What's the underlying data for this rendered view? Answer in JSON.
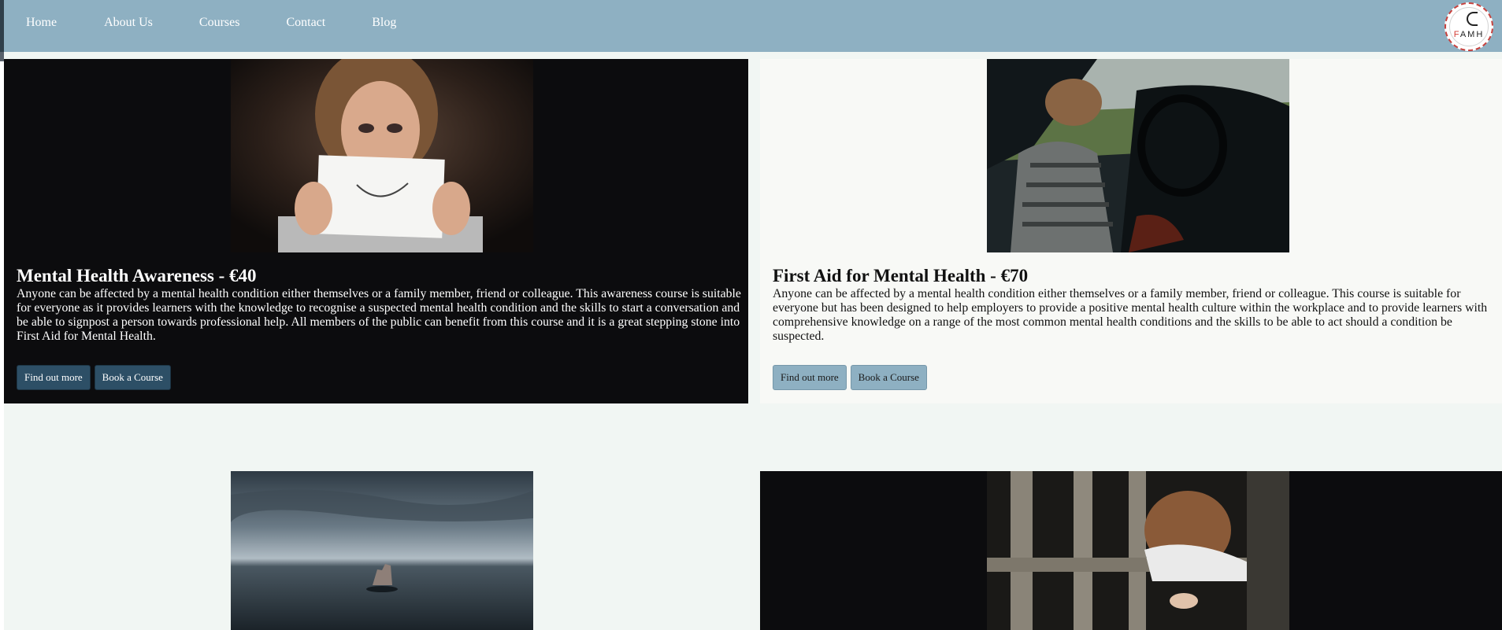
{
  "nav": {
    "items": [
      {
        "label": "Home"
      },
      {
        "label": "About Us"
      },
      {
        "label": "Courses"
      },
      {
        "label": "Contact"
      },
      {
        "label": "Blog"
      }
    ]
  },
  "logo": {
    "letters": "FAMH"
  },
  "courses": [
    {
      "title": "Mental Health Awareness - €40",
      "description": "Anyone can be affected by a mental health condition either themselves or a family member, friend or colleague. This awareness course is suitable for everyone as it provides learners with the knowledge to recognise a suspected mental health condition and the skills to start a conversation and be able to signpost a person towards professional help. All members of the public can benefit from this course and it is a great stepping stone into First Aid for Mental Health.",
      "find_out_more": "Find out more",
      "book": "Book a Course"
    },
    {
      "title": "First Aid for Mental Health - €70",
      "description": "Anyone can be affected by a mental health condition either themselves or a family member, friend or colleague. This course is suitable for everyone but has been designed to help employers to provide a positive mental health culture within the workplace and to provide learners with comprehensive knowledge on a range of the most common mental health conditions and the skills to be able to act should a condition be suspected.",
      "find_out_more": "Find out more",
      "book": "Book a Course"
    }
  ],
  "colors": {
    "header_bg": "#8eb0c2",
    "dark_card_bg": "#0c0c0e",
    "light_card_bg": "#f8f9f6",
    "dark_button": "#2d4f66",
    "light_button": "#8eb0c2"
  }
}
